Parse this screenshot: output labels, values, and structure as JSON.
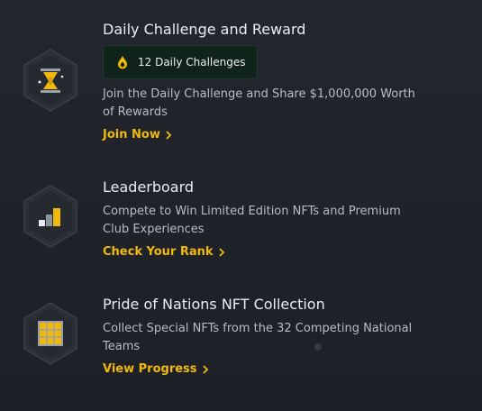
{
  "sections": [
    {
      "title": "Daily Challenge and Reward",
      "badge": {
        "label": "12 Daily Challenges",
        "icon": "drop-icon"
      },
      "description": "Join the Daily Challenge and Share $1,000,000 Worth of Rewards",
      "link": "Join Now",
      "icon": "hourglass-icon"
    },
    {
      "title": "Leaderboard",
      "description": "Compete to Win Limited Edition NFTs and Premium Club Experiences",
      "link": "Check Your Rank",
      "icon": "bar-chart-icon"
    },
    {
      "title": "Pride of Nations NFT Collection",
      "description": "Collect Special NFTs from the 32 Competing National Teams",
      "link": "View Progress",
      "icon": "grid-icon"
    }
  ],
  "colors": {
    "accent": "#f0b90b",
    "background": "#1f2329",
    "badge_bg": "#10231b",
    "text_primary": "#eaecef",
    "text_secondary": "#b7bdc6"
  }
}
